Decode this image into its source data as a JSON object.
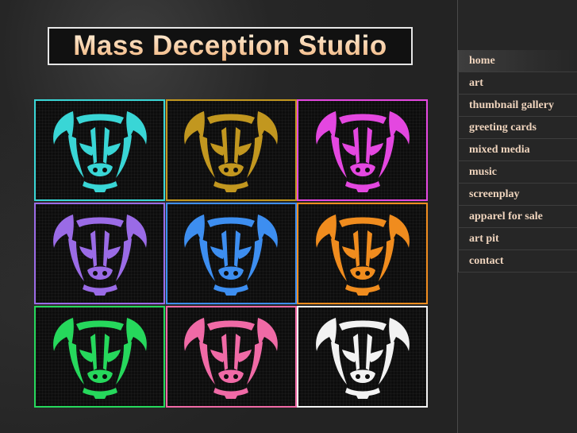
{
  "site": {
    "title": "Mass Deception Studio"
  },
  "nav": {
    "items": [
      {
        "id": "home",
        "label": "home",
        "active": true
      },
      {
        "id": "art",
        "label": "art"
      },
      {
        "id": "thumbnail-gallery",
        "label": "thumbnail gallery"
      },
      {
        "id": "greeting-cards",
        "label": "greeting cards"
      },
      {
        "id": "mixed-media",
        "label": "mixed media"
      },
      {
        "id": "music",
        "label": "music"
      },
      {
        "id": "screenplay",
        "label": "screenplay"
      },
      {
        "id": "apparel-for-sale",
        "label": "apparel for sale"
      },
      {
        "id": "art-pit",
        "label": "art pit"
      },
      {
        "id": "contact",
        "label": "contact"
      }
    ]
  },
  "gallery": {
    "icon": "dog-face-icon",
    "tiles": [
      {
        "color": "#39d6d6"
      },
      {
        "color": "#c2971f"
      },
      {
        "color": "#e447e0"
      },
      {
        "color": "#9a6be6"
      },
      {
        "color": "#3d8ef0"
      },
      {
        "color": "#f08c1e"
      },
      {
        "color": "#26d85c"
      },
      {
        "color": "#f06aa6"
      },
      {
        "color": "#f2f2f2"
      }
    ]
  }
}
